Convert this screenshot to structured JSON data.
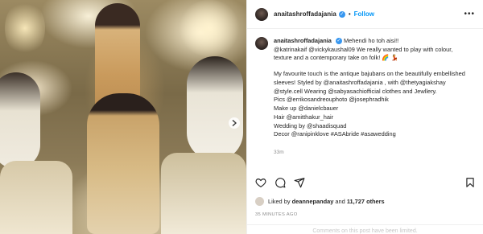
{
  "post": {
    "username": "anaitashroffadajania",
    "follow_label": "Follow",
    "more_glyph": "•••",
    "dot": "•",
    "caption_lines": [
      "Mehendi ho toh aisi!!",
      "@katrinakaif @vickykaushal09 We really wanted to play with colour, texture and a contemporary take on folk! 🌈 💃",
      "",
      "My favourite touch is the antique bajubans on the beautifully embellished sleeves! Styled by @anaitashroffadajania , with @thetyagiakshay @style.cell Wearing @sabyasachiofficial clothes and Jewllery.",
      "Pics @errikosandreouphoto @josephradhik",
      "Make up @danielcbauer",
      "Hair @amitthakur_hair",
      "Wedding by @shaadisquad",
      "Decor @ranipinklove #ASAbride #asawedding"
    ],
    "caption_time": "33m",
    "likes_prefix": "Liked by",
    "likes_user": "deannepanday",
    "likes_and": "and",
    "likes_count": "11,727 others",
    "time_ago": "35 MINUTES AGO",
    "comments_notice": "Comments on this post have been limited."
  },
  "icons": {
    "next": "chevron-right-icon",
    "like": "heart-icon",
    "comment": "comment-icon",
    "share": "share-icon",
    "save": "bookmark-icon",
    "verified": "verified-badge-icon"
  },
  "colors": {
    "accent": "#0095f6",
    "verified": "#3897f0",
    "text": "#262626",
    "muted": "#8e8e8e"
  }
}
